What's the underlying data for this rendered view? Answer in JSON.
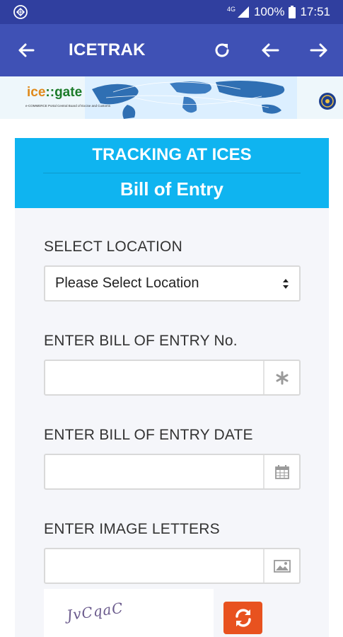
{
  "status_bar": {
    "network": "4G",
    "battery": "100%",
    "time": "17:51"
  },
  "app_bar": {
    "title": "ICETRAK",
    "icons": [
      "back-arrow-icon",
      "refresh-icon",
      "prev-arrow-icon",
      "next-arrow-icon"
    ]
  },
  "banner": {
    "logo_part1": "ice",
    "logo_sep": "::",
    "logo_part2": "gate",
    "tagline": "e-COMMERCE Portal Central Board of Excise and Customs"
  },
  "card": {
    "heading": "TRACKING AT ICES",
    "subheading": "Bill of Entry"
  },
  "form": {
    "location_label": "SELECT LOCATION",
    "location_value": "Please Select Location",
    "be_no_label": "ENTER BILL OF ENTRY No.",
    "be_no_value": "",
    "be_date_label": "ENTER BILL OF ENTRY DATE",
    "be_date_value": "",
    "image_letters_label": "ENTER IMAGE LETTERS",
    "image_letters_value": "",
    "captcha_text": "JvCqaC"
  },
  "colors": {
    "status_bar": "#303f9f",
    "app_bar": "#3f51b5",
    "card_header": "#0fb4f0",
    "refresh_button": "#e8521f"
  }
}
